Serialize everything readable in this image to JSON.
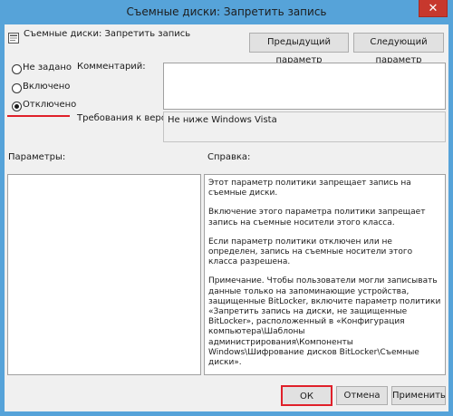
{
  "window": {
    "title": "Съемные диски: Запретить запись",
    "close_glyph": "✕"
  },
  "header": {
    "policy_name": "Съемные диски: Запретить запись",
    "prev_button": "Предыдущий параметр",
    "next_button": "Следующий параметр"
  },
  "state": {
    "options": [
      {
        "label": "Не задано",
        "selected": false
      },
      {
        "label": "Включено",
        "selected": false
      },
      {
        "label": "Отключено",
        "selected": true
      }
    ]
  },
  "comment": {
    "label": "Комментарий:",
    "value": ""
  },
  "supported": {
    "label": "Требования к версии:",
    "value": "Не ниже Windows Vista"
  },
  "params": {
    "label": "Параметры:"
  },
  "help": {
    "label": "Справка:",
    "paragraphs": [
      "Этот параметр политики запрещает запись на съемные диски.",
      "Включение этого параметра политики запрещает запись на съемные носители этого класса.",
      "Если параметр политики отключен или не определен, запись на съемные носители этого класса разрешена.",
      "Примечание. Чтобы пользователи могли записывать данные только на запоминающие устройства, защищенные BitLocker, включите параметр политики «Запретить запись на диски, не защищенные BitLocker», расположенный в «Конфигурация компьютера\\Шаблоны администрирования\\Компоненты Windows\\Шифрование дисков BitLocker\\Съемные диски»."
    ]
  },
  "footer": {
    "ok": "ОК",
    "cancel": "Отмена",
    "apply": "Применить"
  },
  "colors": {
    "frame": "#56a3d9",
    "close": "#c7382d",
    "highlight": "#e0202a"
  }
}
